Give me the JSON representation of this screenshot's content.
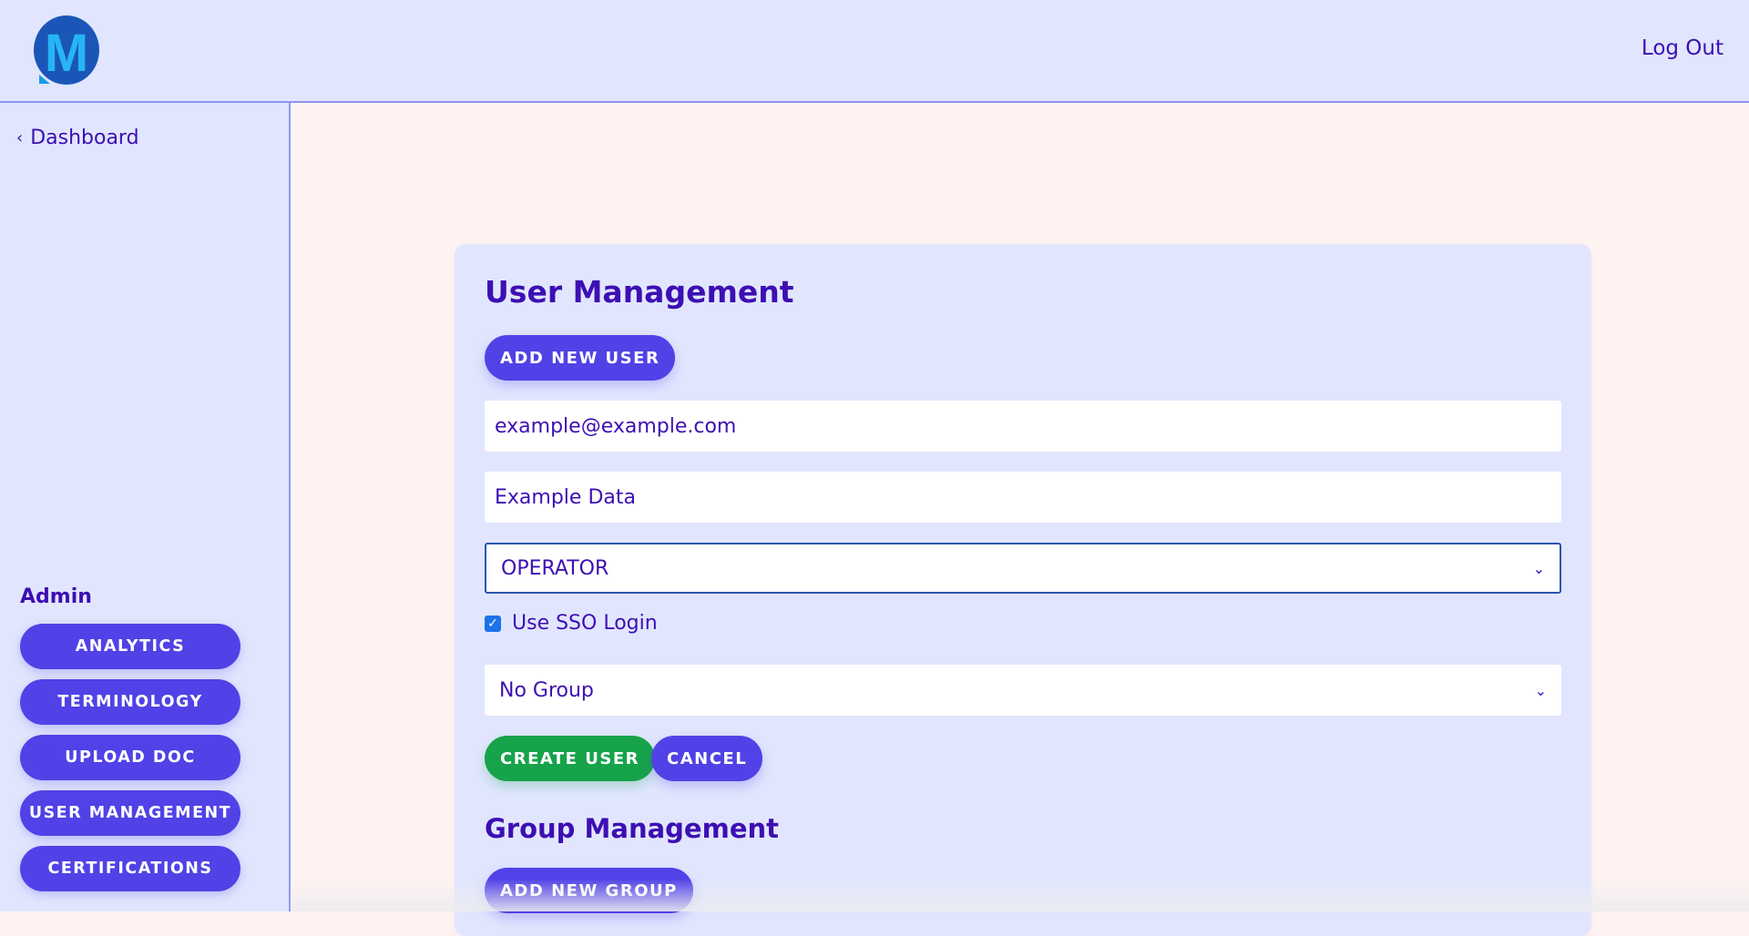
{
  "header": {
    "logo_letter": "M",
    "logout_label": "Log Out"
  },
  "sidebar": {
    "back_label": "Dashboard",
    "admin_title": "Admin",
    "buttons": [
      {
        "label": "ANALYTICS"
      },
      {
        "label": "TERMINOLOGY"
      },
      {
        "label": "UPLOAD DOC"
      },
      {
        "label": "USER MANAGEMENT"
      },
      {
        "label": "CERTIFICATIONS"
      }
    ]
  },
  "main": {
    "user_title": "User Management",
    "add_user_label": "ADD NEW USER",
    "email_value": "example@example.com",
    "name_value": "Example Data",
    "role_selected": "OPERATOR",
    "sso_label": "Use SSO Login",
    "sso_checked": true,
    "group_selected": "No Group",
    "create_label": "CREATE USER",
    "cancel_label": "CANCEL",
    "group_title": "Group Management",
    "add_group_label": "ADD NEW GROUP"
  },
  "colors": {
    "accent": "#5042e6",
    "success": "#16a34a",
    "text": "#3d0fb3",
    "panel": "#e1e6fe",
    "background": "#fff3f2"
  }
}
